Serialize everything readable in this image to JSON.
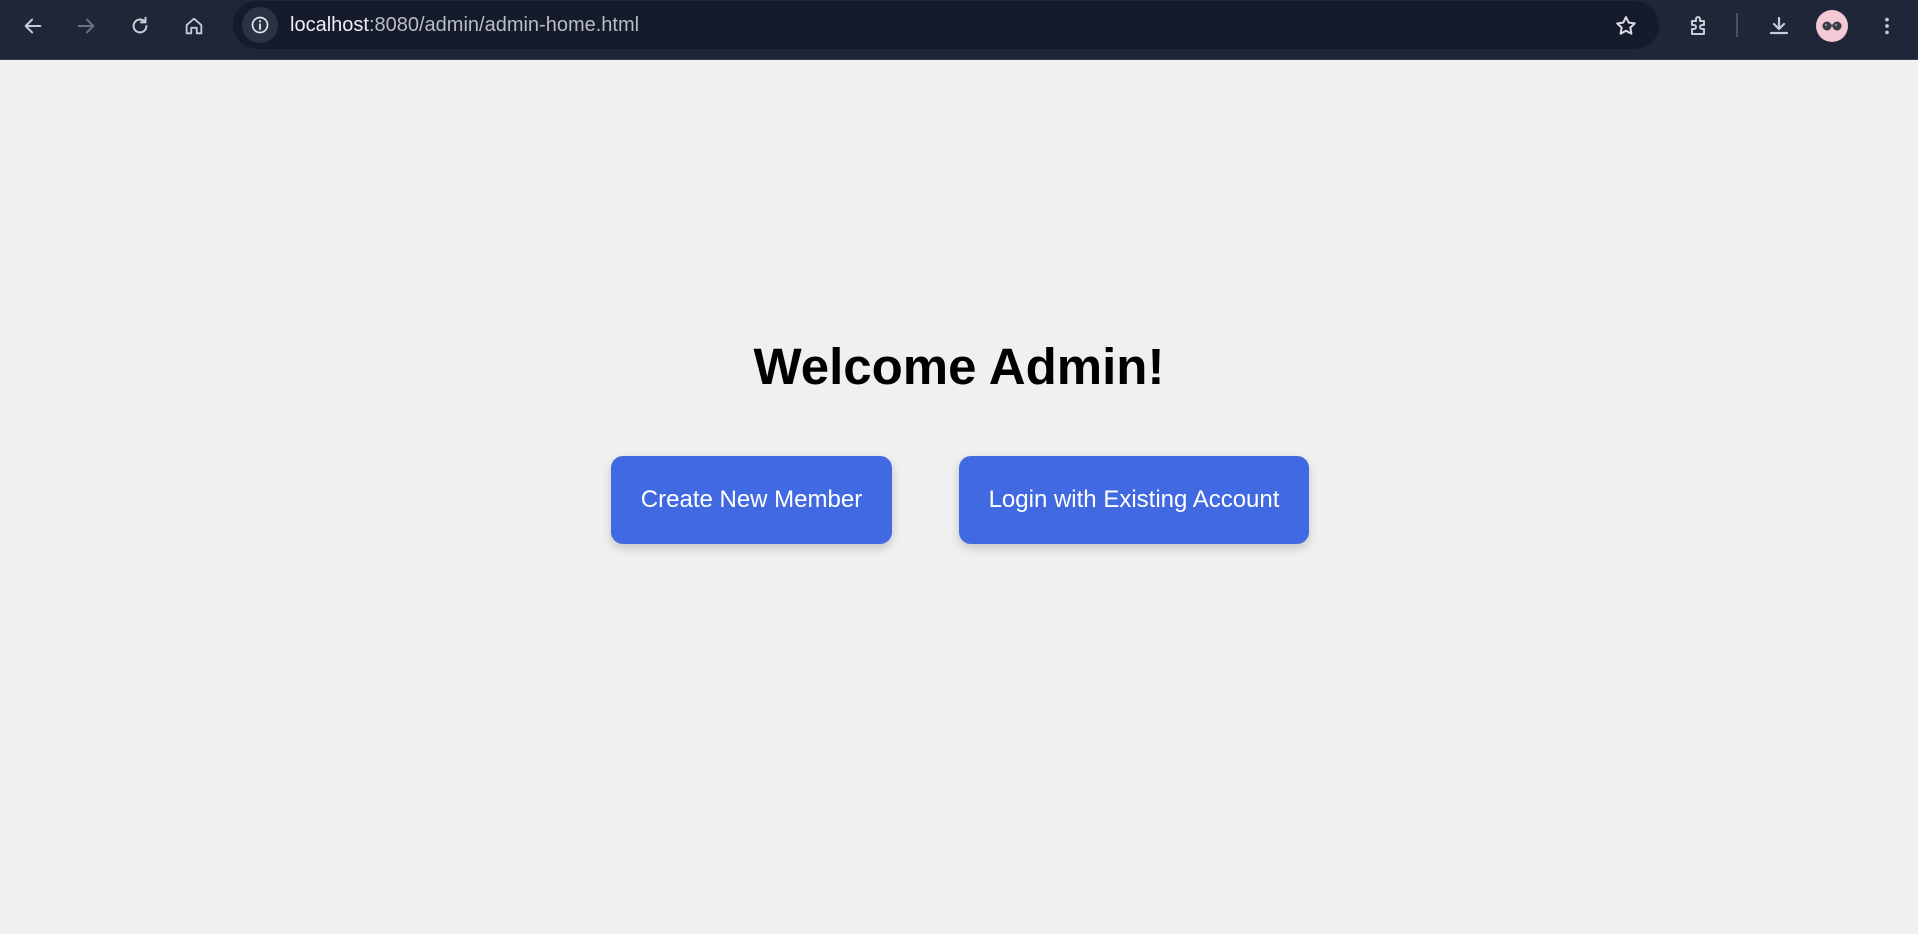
{
  "browser": {
    "url_host": "localhost",
    "url_rest": ":8080/admin/admin-home.html",
    "colors": {
      "toolbar": "#1f2638",
      "omnibox": "#151b2b",
      "icon": "#c9ccd4",
      "icon_disabled": "#6b7182"
    },
    "icons": [
      "back-icon",
      "forward-icon",
      "reload-icon",
      "home-icon",
      "site-info-icon",
      "bookmark-star-icon",
      "extensions-icon",
      "download-icon",
      "profile-avatar",
      "more-menu-icon"
    ]
  },
  "page": {
    "title": "Welcome Admin!",
    "buttons": {
      "create_label": "Create New Member",
      "login_label": "Login with Existing Account"
    },
    "colors": {
      "background": "#f0f0f0",
      "button": "#4169e1",
      "button_text": "#ffffff",
      "title": "#000000"
    }
  }
}
